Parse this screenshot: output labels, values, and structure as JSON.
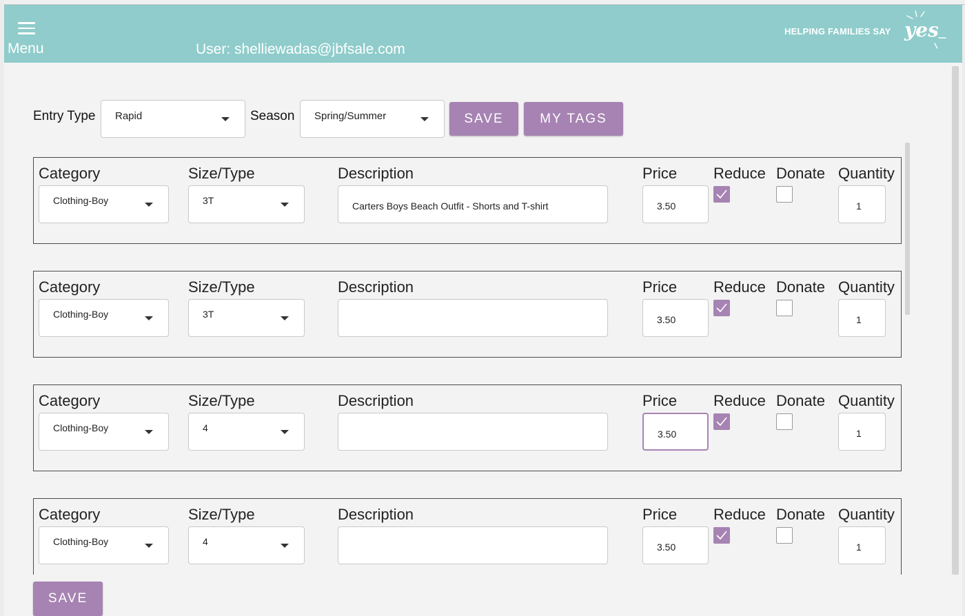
{
  "header": {
    "menu_label": "Menu",
    "user_label": "User: shelliewadas@jbfsale.com",
    "brand_text": "HELPING FAMILIES SAY",
    "brand_word": "yes"
  },
  "toolbar": {
    "entry_type_label": "Entry Type",
    "entry_type_value": "Rapid",
    "season_label": "Season",
    "season_value": "Spring/Summer",
    "save_label": "SAVE",
    "my_tags_label": "MY TAGS"
  },
  "field_labels": {
    "category": "Category",
    "size_type": "Size/Type",
    "description": "Description",
    "price": "Price",
    "reduce": "Reduce",
    "donate": "Donate",
    "quantity": "Quantity"
  },
  "items": [
    {
      "category": "Clothing-Boy",
      "size": "3T",
      "description": "Carters Boys Beach Outfit - Shorts and T-shirt",
      "price": "3.50",
      "reduce": true,
      "donate": false,
      "quantity": "1"
    },
    {
      "category": "Clothing-Boy",
      "size": "3T",
      "description": "",
      "price": "3.50",
      "reduce": true,
      "donate": false,
      "quantity": "1"
    },
    {
      "category": "Clothing-Boy",
      "size": "4",
      "description": "",
      "price": "3.50",
      "reduce": true,
      "donate": false,
      "quantity": "1",
      "focused": true
    },
    {
      "category": "Clothing-Boy",
      "size": "4",
      "description": "",
      "price": "3.50",
      "reduce": true,
      "donate": false,
      "quantity": "1"
    }
  ],
  "footer": {
    "save_label": "SAVE"
  },
  "colors": {
    "header_bg": "#8fcccb",
    "accent": "#a683b2"
  }
}
